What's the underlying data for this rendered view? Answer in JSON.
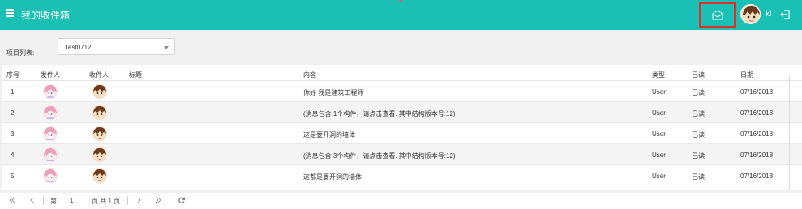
{
  "header": {
    "title": "我的收件箱",
    "username": "kl",
    "bg_color": "#1bc0b4",
    "menu_icon": "hamburger-icon",
    "mail_icon": "envelope-open-icon",
    "logout_icon": "logout-icon"
  },
  "filter": {
    "label": "项目列表:",
    "selected": "Test0712"
  },
  "table": {
    "columns": [
      "序号",
      "发件人",
      "收件人",
      "标题",
      "内容",
      "类型",
      "已读",
      "日期"
    ],
    "rows": [
      {
        "index": "1",
        "title": "",
        "content": "你好 我是建筑工程师",
        "type": "User",
        "read": "已读",
        "date": "07/16/2018"
      },
      {
        "index": "2",
        "title": "",
        "content": "(消息包含:1个构件，请点击查看. 其中结构版本号:12)",
        "type": "User",
        "read": "已读",
        "date": "07/16/2018"
      },
      {
        "index": "3",
        "title": "",
        "content": "这是要开洞的墙体",
        "type": "User",
        "read": "已读",
        "date": "07/16/2018"
      },
      {
        "index": "4",
        "title": "",
        "content": "(消息包含:3个构件，请点击查看. 其中结构版本号:12)",
        "type": "User",
        "read": "已读",
        "date": "07/16/2018"
      },
      {
        "index": "5",
        "title": "",
        "content": "这都是要开洞的墙体",
        "type": "User",
        "read": "已读",
        "date": "07/16/2018"
      }
    ]
  },
  "pager": {
    "page_prefix": "第",
    "current_page": "1",
    "page_suffix": "页,共 1 页"
  }
}
